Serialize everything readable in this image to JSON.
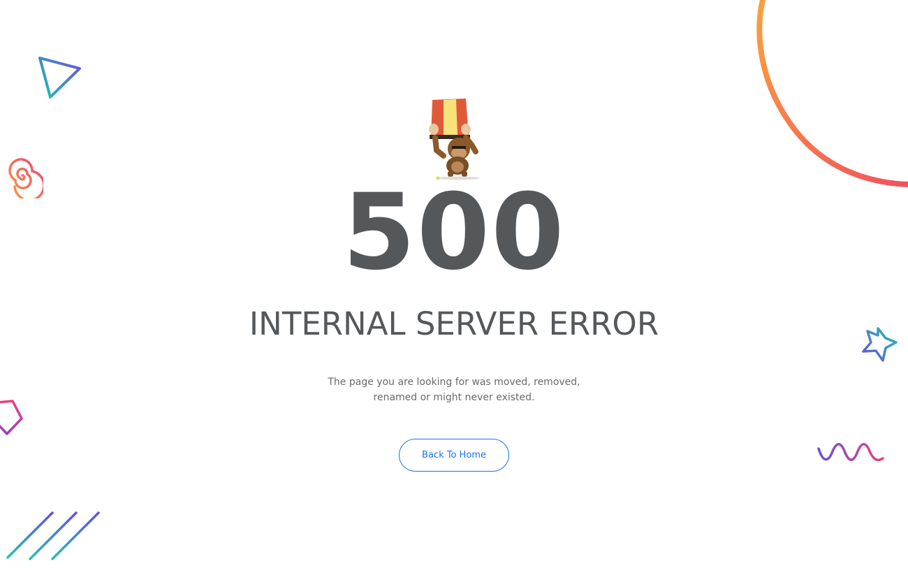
{
  "error": {
    "code": "500",
    "title": "INTERNAL SERVER ERROR",
    "description_line1": "The page you are looking for was moved, removed,",
    "description_line2": "renamed or might never existed."
  },
  "actions": {
    "back_home_label": "Back To Home"
  },
  "colors": {
    "heading": "#55585b",
    "body_text": "#66696c",
    "button_accent": "#1a73e8",
    "deco_teal": "#1ec4b0",
    "deco_purple": "#6a4fd6",
    "deco_orange": "#f9a03f",
    "deco_pink": "#e6417e"
  },
  "icons": {
    "mascot": "monkey-holding-bucket-icon",
    "decorations": [
      "triangle-icon",
      "spiral-icon",
      "pentagon-icon",
      "diagonal-lines-icon",
      "arc-icon",
      "star-icon",
      "wave-icon"
    ]
  }
}
